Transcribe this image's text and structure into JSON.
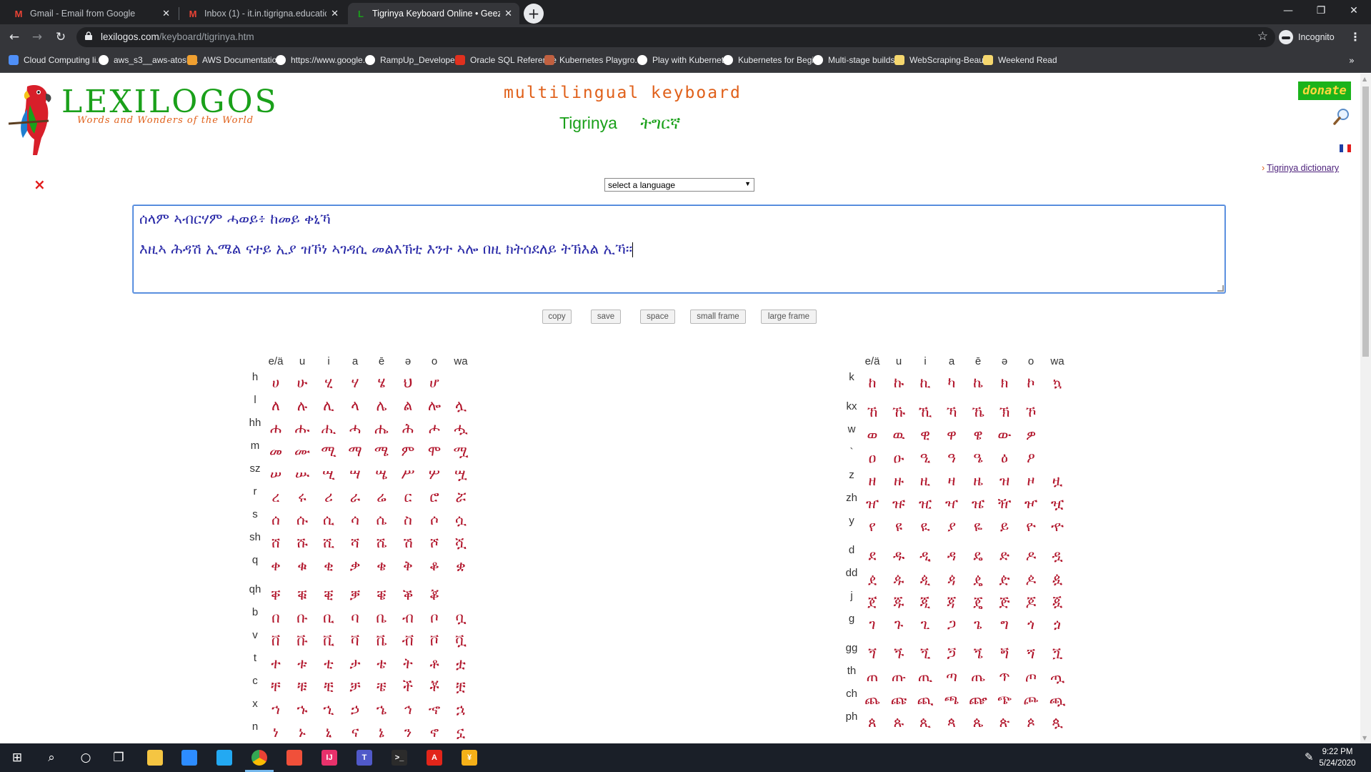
{
  "browser": {
    "tabs": [
      {
        "title": "Gmail - Email from Google",
        "icon": "gmail-icon",
        "active": false
      },
      {
        "title": "Inbox (1) - it.in.tigrigna.education@",
        "icon": "gmail-icon",
        "active": false
      },
      {
        "title": "Tigrinya Keyboard Online • Geez",
        "icon": "lexilogos-icon",
        "active": true
      }
    ],
    "new_tab_label": "+",
    "url_domain": "lexilogos.com",
    "url_path": "/keyboard/tigrinya.htm",
    "profile_label": "Incognito",
    "bookmarks": [
      {
        "label": "Cloud Computing li...",
        "icon": "cloud-icon",
        "color": "#4f8ff7"
      },
      {
        "label": "aws_s3__aws-atosh...",
        "icon": "github-icon",
        "color": "#ffffff"
      },
      {
        "label": "AWS Documentation",
        "icon": "aws-icon",
        "color": "#f0a030"
      },
      {
        "label": "https://www.google...",
        "icon": "google-icon",
        "color": "#ffffff"
      },
      {
        "label": "RampUp_Developer...",
        "icon": "github-icon",
        "color": "#ffffff"
      },
      {
        "label": "Oracle SQL Reference",
        "icon": "oracle-icon",
        "color": "#e0301e"
      },
      {
        "label": "Kubernetes Playgro...",
        "icon": "katacoda-icon",
        "color": "#c06040"
      },
      {
        "label": "Play with Kubernetes",
        "icon": "github-icon",
        "color": "#ffffff"
      },
      {
        "label": "Kubernetes for Begi...",
        "icon": "github-icon",
        "color": "#ffffff"
      },
      {
        "label": "Multi-stage builds",
        "icon": "github-icon",
        "color": "#ffffff"
      },
      {
        "label": "WebScraping-Beaut...",
        "icon": "folder-icon",
        "color": "#f5d76e"
      },
      {
        "label": "Weekend Read",
        "icon": "folder-icon",
        "color": "#f5d76e"
      }
    ],
    "bookmarks_more": "»"
  },
  "page": {
    "logo_title": "LEXILOGOS",
    "logo_subtitle": "Words and Wonders of the World",
    "heading": "multilingual keyboard",
    "language_en": "Tigrinya",
    "language_native": "ትግርኛ",
    "donate_label": "donate",
    "dictionary_link": "Tigrinya dictionary",
    "language_select": "select a language",
    "clear_symbol": "×",
    "text_line1": "ሰላም ኣብርሃም ሓወይ፥ ከመይ ቀኒኻ",
    "text_line2": "እዚኣ ሕዳሽ ኢሜል ናተይ ኢያ ዝኾነ ኣገዳሲ መልእኽቲ እንተ ኣሎ በዚ ክትሰደለይ ትኽእል ኢኻ፡፡",
    "buttons": {
      "copy": "copy",
      "save": "save",
      "space": "space",
      "small_frame": "small frame",
      "large_frame": "large frame"
    }
  },
  "keyboard_headers": [
    "e/ä",
    "u",
    "i",
    "a",
    "ē",
    "ə",
    "o",
    "wa"
  ],
  "keyboard_left": [
    {
      "key": "h",
      "chars": [
        "ሀ",
        "ሁ",
        "ሂ",
        "ሃ",
        "ሄ",
        "ህ",
        "ሆ",
        ""
      ]
    },
    {
      "key": "l",
      "chars": [
        "ለ",
        "ሉ",
        "ሊ",
        "ላ",
        "ሌ",
        "ል",
        "ሎ",
        "ሏ"
      ]
    },
    {
      "key": "hh",
      "chars": [
        "ሐ",
        "ሑ",
        "ሒ",
        "ሓ",
        "ሔ",
        "ሕ",
        "ሖ",
        "ሗ"
      ]
    },
    {
      "key": "m",
      "chars": [
        "መ",
        "ሙ",
        "ሚ",
        "ማ",
        "ሜ",
        "ም",
        "ሞ",
        "ሟ"
      ]
    },
    {
      "key": "sz",
      "chars": [
        "ሠ",
        "ሡ",
        "ሢ",
        "ሣ",
        "ሤ",
        "ሥ",
        "ሦ",
        "ሧ"
      ]
    },
    {
      "key": "r",
      "chars": [
        "ረ",
        "ሩ",
        "ሪ",
        "ራ",
        "ሬ",
        "ር",
        "ሮ",
        "ሯ"
      ]
    },
    {
      "key": "s",
      "chars": [
        "ሰ",
        "ሱ",
        "ሲ",
        "ሳ",
        "ሴ",
        "ስ",
        "ሶ",
        "ሷ"
      ]
    },
    {
      "key": "sh",
      "chars": [
        "ሸ",
        "ሹ",
        "ሺ",
        "ሻ",
        "ሼ",
        "ሽ",
        "ሾ",
        "ሿ"
      ]
    },
    {
      "key": "q",
      "chars": [
        "ቀ",
        "ቁ",
        "ቂ",
        "ቃ",
        "ቄ",
        "ቅ",
        "ቆ",
        "ቋ"
      ]
    },
    {
      "key": "qh",
      "chars": [
        "ቐ",
        "ቑ",
        "ቒ",
        "ቓ",
        "ቔ",
        "ቕ",
        "ቖ",
        ""
      ]
    },
    {
      "key": "b",
      "chars": [
        "በ",
        "ቡ",
        "ቢ",
        "ባ",
        "ቤ",
        "ብ",
        "ቦ",
        "ቧ"
      ]
    },
    {
      "key": "v",
      "chars": [
        "ቨ",
        "ቩ",
        "ቪ",
        "ቫ",
        "ቬ",
        "ቭ",
        "ቮ",
        "ቯ"
      ]
    },
    {
      "key": "t",
      "chars": [
        "ተ",
        "ቱ",
        "ቲ",
        "ታ",
        "ቴ",
        "ት",
        "ቶ",
        "ቷ"
      ]
    },
    {
      "key": "c",
      "chars": [
        "ቸ",
        "ቹ",
        "ቺ",
        "ቻ",
        "ቼ",
        "ች",
        "ቾ",
        "ቿ"
      ]
    },
    {
      "key": "x",
      "chars": [
        "ኀ",
        "ኁ",
        "ኂ",
        "ኃ",
        "ኄ",
        "ኅ",
        "ኆ",
        "ኋ"
      ]
    },
    {
      "key": "n",
      "chars": [
        "ነ",
        "ኑ",
        "ኒ",
        "ና",
        "ኔ",
        "ን",
        "ኖ",
        "ኗ"
      ]
    }
  ],
  "keyboard_right": [
    {
      "key": "k",
      "chars": [
        "ከ",
        "ኩ",
        "ኪ",
        "ካ",
        "ኬ",
        "ክ",
        "ኮ",
        "ኳ"
      ]
    },
    {
      "key": "kx",
      "chars": [
        "ኸ",
        "ኹ",
        "ኺ",
        "ኻ",
        "ኼ",
        "ኽ",
        "ኾ",
        ""
      ]
    },
    {
      "key": "w",
      "chars": [
        "ወ",
        "ዉ",
        "ዊ",
        "ዋ",
        "ዌ",
        "ው",
        "ዎ",
        ""
      ]
    },
    {
      "key": "`",
      "chars": [
        "ዐ",
        "ዑ",
        "ዒ",
        "ዓ",
        "ዔ",
        "ዕ",
        "ዖ",
        ""
      ]
    },
    {
      "key": "z",
      "chars": [
        "ዘ",
        "ዙ",
        "ዚ",
        "ዛ",
        "ዜ",
        "ዝ",
        "ዞ",
        "ዟ"
      ]
    },
    {
      "key": "zh",
      "chars": [
        "ዠ",
        "ዡ",
        "ዢ",
        "ዣ",
        "ዤ",
        "ዥ",
        "ዦ",
        "ዧ"
      ]
    },
    {
      "key": "y",
      "chars": [
        "የ",
        "ዩ",
        "ዪ",
        "ያ",
        "ዬ",
        "ይ",
        "ዮ",
        "ዯ"
      ]
    },
    {
      "key": "d",
      "chars": [
        "ደ",
        "ዱ",
        "ዲ",
        "ዳ",
        "ዴ",
        "ድ",
        "ዶ",
        "ዷ"
      ]
    },
    {
      "key": "dd",
      "chars": [
        "ዸ",
        "ዹ",
        "ዺ",
        "ዻ",
        "ዼ",
        "ዽ",
        "ዾ",
        "ዿ"
      ]
    },
    {
      "key": "j",
      "chars": [
        "ጀ",
        "ጁ",
        "ጂ",
        "ጃ",
        "ጄ",
        "ጅ",
        "ጆ",
        "ጇ"
      ]
    },
    {
      "key": "g",
      "chars": [
        "ገ",
        "ጉ",
        "ጊ",
        "ጋ",
        "ጌ",
        "ግ",
        "ጎ",
        "ጏ"
      ]
    },
    {
      "key": "gg",
      "chars": [
        "ጘ",
        "ጙ",
        "ጚ",
        "ጛ",
        "ጜ",
        "ጝ",
        "ጞ",
        "ጟ"
      ]
    },
    {
      "key": "th",
      "chars": [
        "ጠ",
        "ጡ",
        "ጢ",
        "ጣ",
        "ጤ",
        "ጥ",
        "ጦ",
        "ጧ"
      ]
    },
    {
      "key": "ch",
      "chars": [
        "ጨ",
        "ጩ",
        "ጪ",
        "ጫ",
        "ጬ",
        "ጭ",
        "ጮ",
        "ጯ"
      ]
    },
    {
      "key": "ph",
      "chars": [
        "ጰ",
        "ጱ",
        "ጲ",
        "ጳ",
        "ጴ",
        "ጵ",
        "ጶ",
        "ጷ"
      ]
    }
  ],
  "taskbar": {
    "apps": [
      "windows-icon",
      "search-icon",
      "cortana-icon",
      "task-view-icon",
      "file-explorer-icon",
      "zoom-icon",
      "vscode-icon",
      "chrome-icon",
      "git-icon",
      "intellij-icon",
      "teams-icon",
      "terminal-icon",
      "acrobat-icon",
      "app-icon"
    ],
    "time": "9:22 PM",
    "date": "5/24/2020"
  }
}
